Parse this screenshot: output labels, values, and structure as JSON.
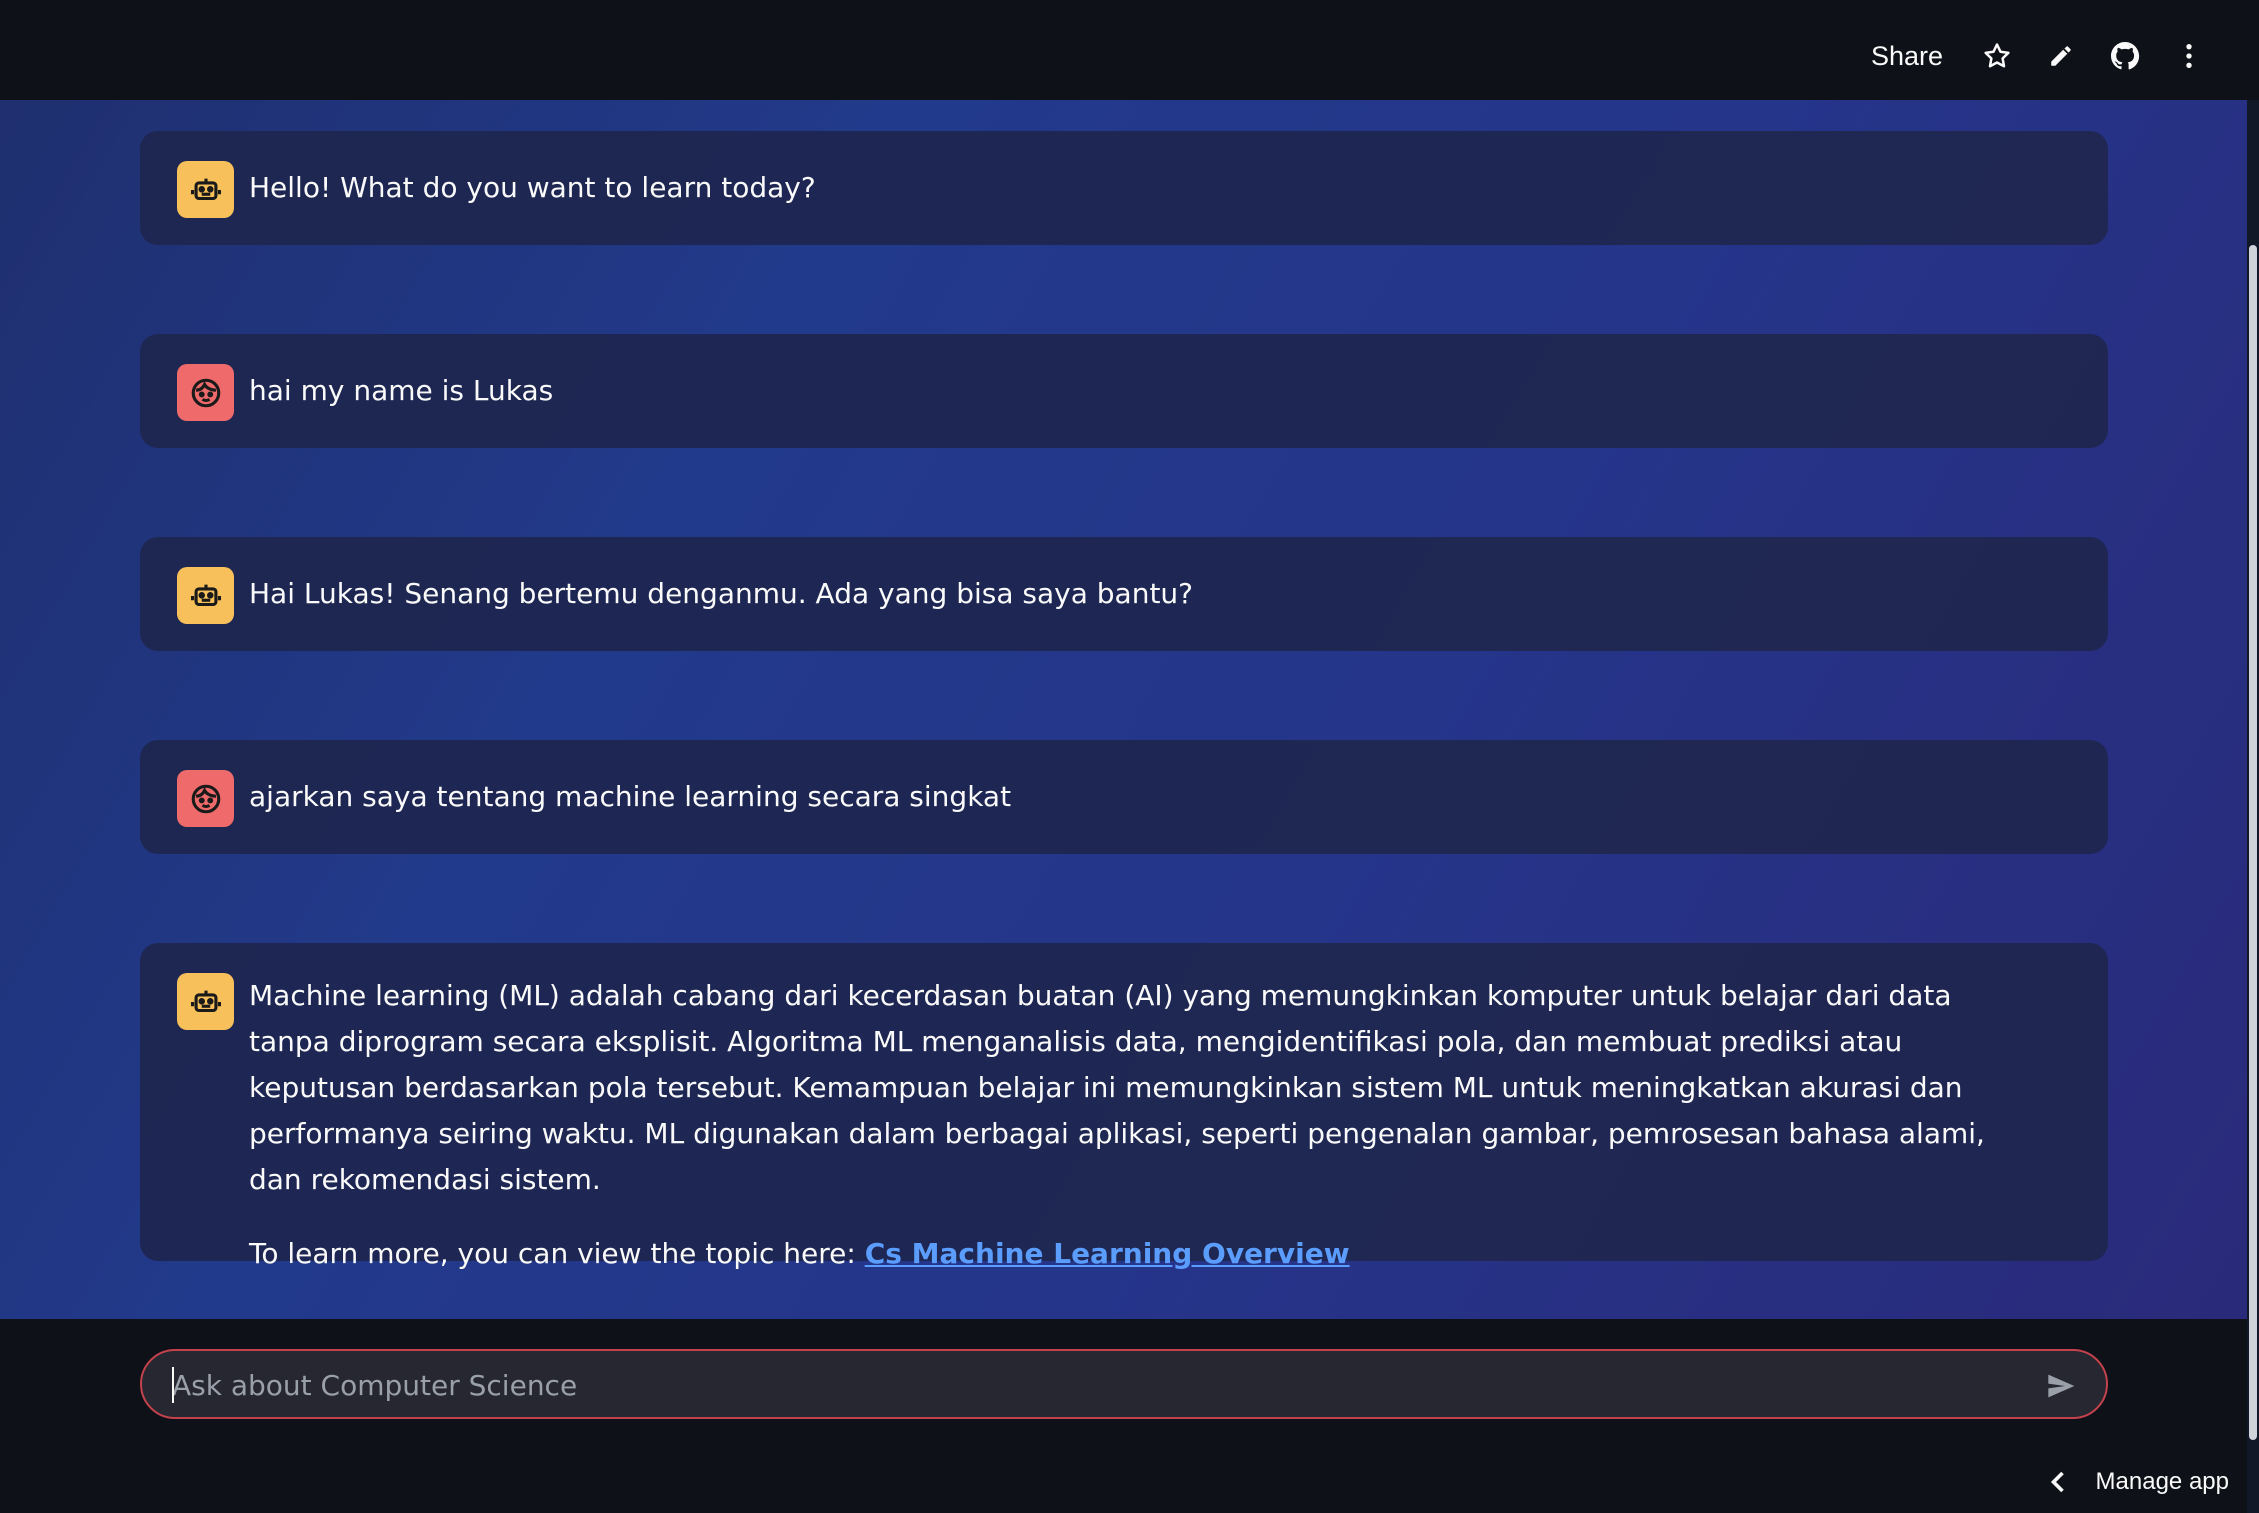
{
  "header": {
    "share_label": "Share",
    "icons": [
      "star-icon",
      "pencil-icon",
      "github-icon",
      "more-vertical-icon"
    ]
  },
  "messages": [
    {
      "role": "assistant",
      "avatar_icon": "robot-icon",
      "paragraphs": [
        "Hello! What do you want to learn today?"
      ]
    },
    {
      "role": "user",
      "avatar_icon": "face-icon",
      "paragraphs": [
        "hai my name is Lukas"
      ]
    },
    {
      "role": "assistant",
      "avatar_icon": "robot-icon",
      "paragraphs": [
        "Hai Lukas! Senang bertemu denganmu. Ada yang bisa saya bantu?"
      ]
    },
    {
      "role": "user",
      "avatar_icon": "face-icon",
      "paragraphs": [
        "ajarkan saya tentang machine learning secara singkat"
      ]
    },
    {
      "role": "assistant",
      "avatar_icon": "robot-icon",
      "paragraphs": [
        "Machine learning (ML) adalah cabang dari kecerdasan buatan (AI) yang memungkinkan komputer untuk belajar dari data tanpa diprogram secara eksplisit. Algoritma ML menganalisis data, mengidentifikasi pola, dan membuat prediksi atau keputusan berdasarkan pola tersebut. Kemampuan belajar ini memungkinkan sistem ML untuk meningkatkan akurasi dan performanya seiring waktu. ML digunakan dalam berbagai aplikasi, seperti pengenalan gambar, pemrosesan bahasa alami, dan rekomendasi sistem."
      ],
      "link_prefix": "To learn more, you can view the topic here: ",
      "link_text": "Cs Machine Learning Overview"
    }
  ],
  "chat_input": {
    "placeholder": "Ask about Computer Science",
    "value": ""
  },
  "footer": {
    "manage_label": "Manage app"
  },
  "colors": {
    "bot_avatar": "#f7c05a",
    "user_avatar": "#ef6b6b",
    "link": "#5b9cff",
    "input_border": "#c4424c"
  }
}
